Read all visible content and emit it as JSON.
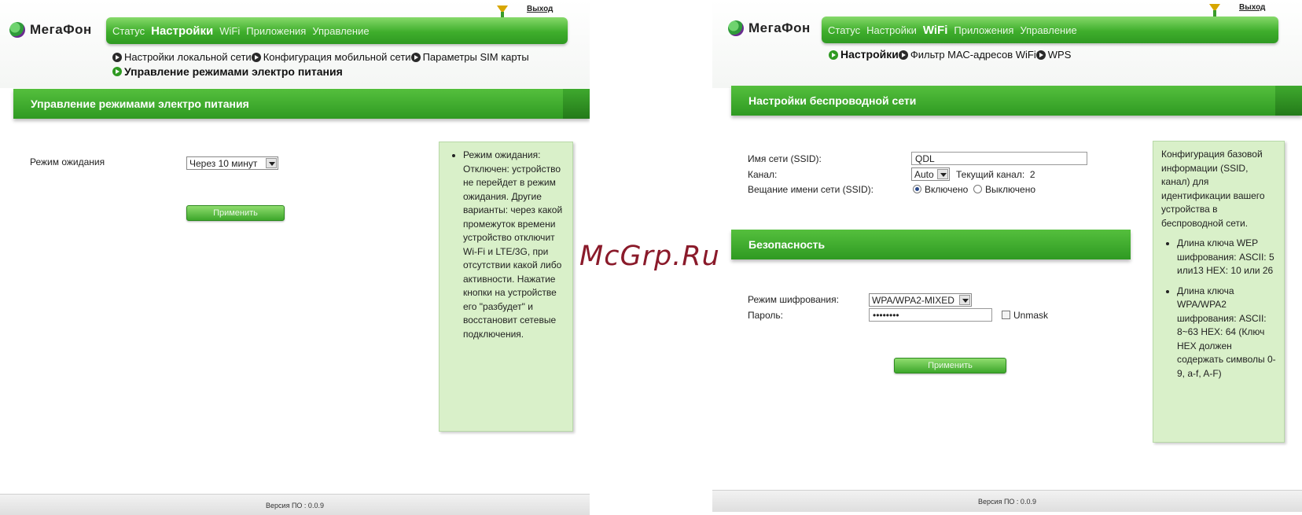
{
  "left": {
    "logo": "МегаФон",
    "logout": "Выход",
    "nav": [
      "Статус",
      "Настройки",
      "WiFi",
      "Приложения",
      "Управление"
    ],
    "sublinks": [
      "Настройки локальной сети",
      "Конфигурация мобильной сети",
      "Параметры SIM карты"
    ],
    "current_sublink": "Управление режимами электро питания",
    "section_title": "Управление режимами электро питания",
    "standby_label": "Режим ожидания",
    "standby_value": "Через 10 минут",
    "apply": "Применить",
    "help": "Режим ожидания: Отключен: устройство не перейдет в режим ожидания. Другие варианты: через какой промежуток времени устройство отключит Wi-Fi и LTE/3G, при отсутствии какой либо активности. Нажатие кнопки на устройстве его \"разбудет\" и восстановит сетевые подключения.",
    "footer": "Версия ПО : 0.0.9"
  },
  "right": {
    "logo": "МегаФон",
    "logout": "Выход",
    "nav": [
      "Статус",
      "Настройки",
      "WiFi",
      "Приложения",
      "Управление"
    ],
    "current_sublink": "Настройки",
    "sublinks": [
      "Фильтр МАС-адресов WiFi",
      "WPS"
    ],
    "section_title": "Настройки беспроводной сети",
    "ssid_label": "Имя сети (SSID):",
    "ssid_value": "QDL",
    "channel_label": "Канал:",
    "channel_value": "Auto",
    "current_channel_label": "Текущий канал:",
    "current_channel_value": "2",
    "broadcast_label": "Вещание имени сети (SSID):",
    "broadcast_on": "Включено",
    "broadcast_off": "Выключено",
    "security_title": "Безопасность",
    "encryption_label": "Режим шифрования:",
    "encryption_value": "WPA/WPA2-MIXED",
    "password_label": "Пароль:",
    "password_value": "••••••••",
    "unmask": "Unmask",
    "apply": "Применить",
    "help_intro": "Конфигурация базовой информации (SSID, канал) для идентификации вашего устройства в беспроводной сети.",
    "help_items": [
      "Длина ключа WEP шифрования: ASCII: 5 или13 HEX: 10 или 26",
      "Длина ключа WPA/WPA2 шифрования: ASCII: 8~63 HEX: 64 (Ключ HEX должен содержать символы 0-9, a-f, A-F)"
    ],
    "footer": "Версия ПО : 0.0.9"
  },
  "watermark": "McGrp.Ru",
  "colors": {
    "brand_green": "#2f9a22",
    "help_bg": "#d9f0c9"
  }
}
